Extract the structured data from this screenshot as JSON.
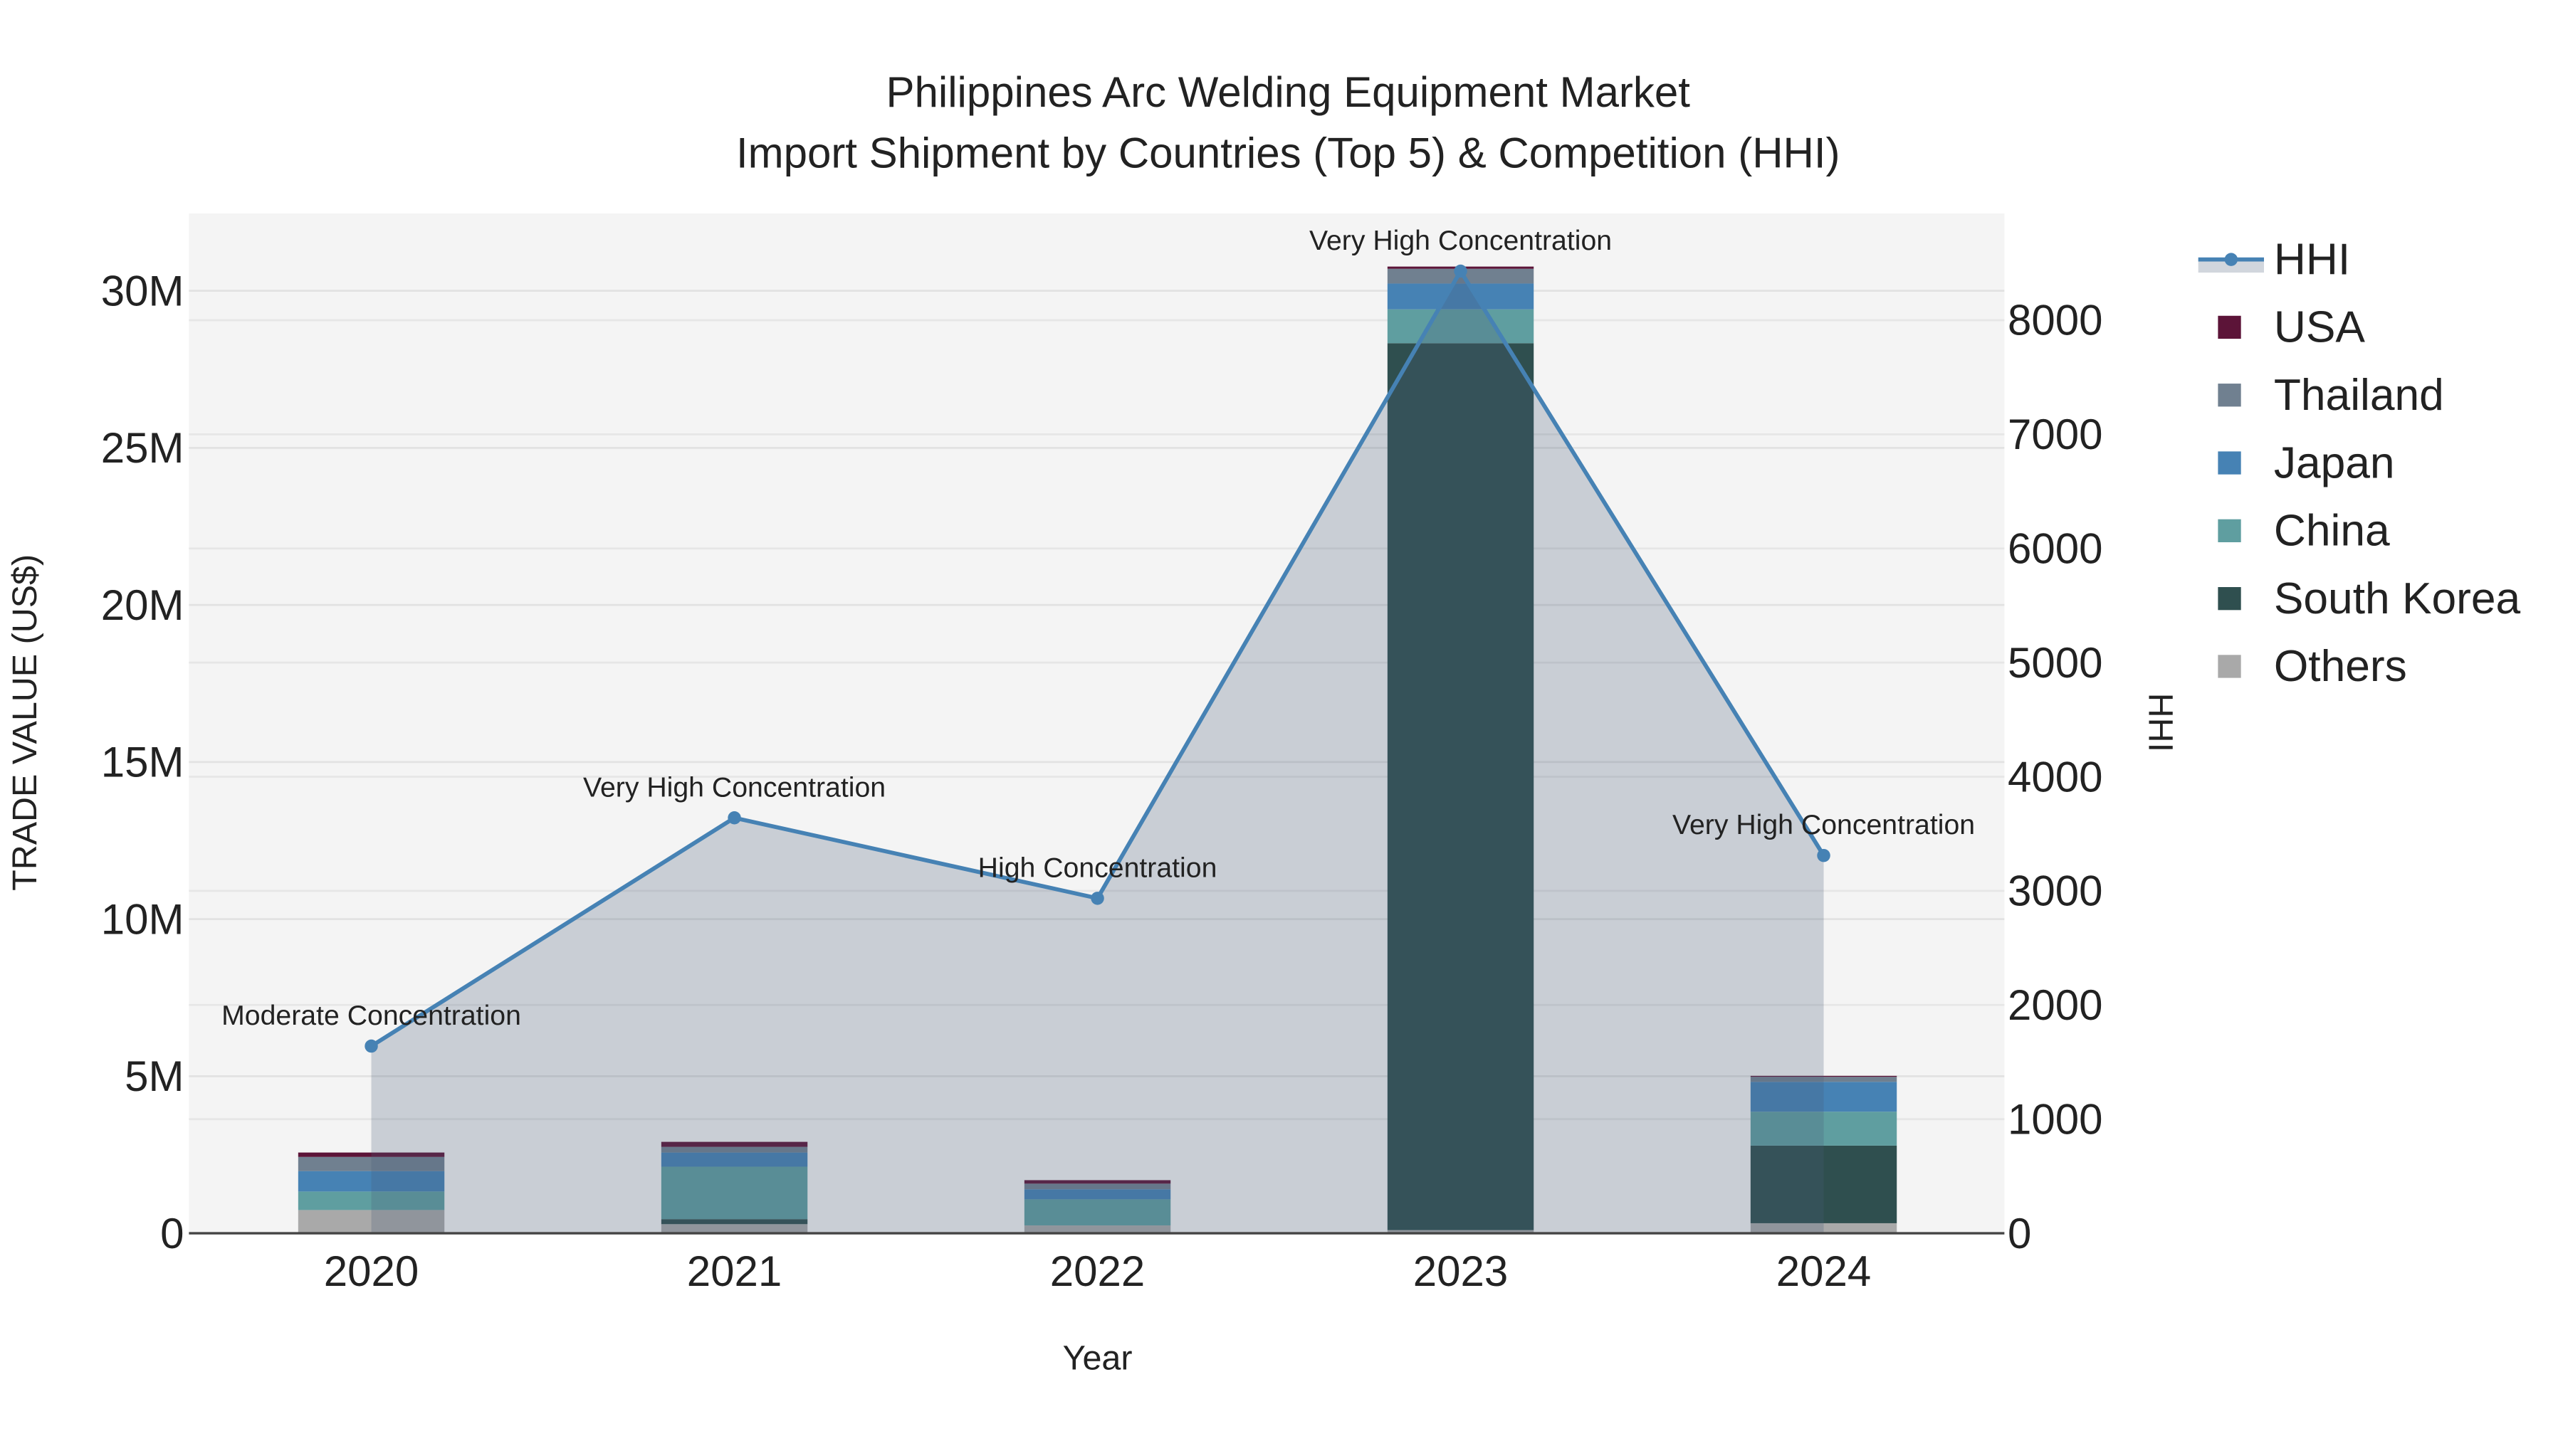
{
  "chart_data": {
    "type": "bar",
    "title_line1": "Philippines Arc Welding Equipment Market",
    "title_line2": "Import Shipment by Countries (Top 5) & Competition (HHI)",
    "xlabel": "Year",
    "ylabel": "TRADE VALUE (US$)",
    "y2label": "HHI",
    "categories": [
      "2020",
      "2021",
      "2022",
      "2023",
      "2024"
    ],
    "ylim": [
      0,
      32460000
    ],
    "y2lim": [
      0,
      8935
    ],
    "yticks": [
      0,
      5000000,
      10000000,
      15000000,
      20000000,
      25000000,
      30000000
    ],
    "ytick_labels": [
      "0",
      "5M",
      "10M",
      "15M",
      "20M",
      "25M",
      "30M"
    ],
    "y2ticks": [
      0,
      1000,
      2000,
      3000,
      4000,
      5000,
      6000,
      7000,
      8000
    ],
    "y2tick_labels": [
      "0",
      "1000",
      "2000",
      "3000",
      "4000",
      "5000",
      "6000",
      "7000",
      "8000"
    ],
    "grid": true,
    "legend_position": "right",
    "stacked": true,
    "series": [
      {
        "name": "Others",
        "color": "#a9a9a9",
        "values": [
          740000,
          290000,
          250000,
          100000,
          320000
        ]
      },
      {
        "name": "South Korea",
        "color": "#2f4f4f",
        "values": [
          0,
          160000,
          0,
          28230000,
          2470000
        ]
      },
      {
        "name": "China",
        "color": "#5f9ea0",
        "values": [
          590000,
          1670000,
          830000,
          1080000,
          1080000
        ]
      },
      {
        "name": "Japan",
        "color": "#4682b4",
        "values": [
          650000,
          450000,
          320000,
          820000,
          950000
        ]
      },
      {
        "name": "Thailand",
        "color": "#708090",
        "values": [
          450000,
          180000,
          180000,
          470000,
          160000
        ]
      },
      {
        "name": "USA",
        "color": "#5c1438",
        "values": [
          140000,
          160000,
          110000,
          70000,
          30000
        ]
      }
    ],
    "hhi": {
      "name": "HHI",
      "color": "#4682b4",
      "values": [
        1640,
        3640,
        2935,
        8430,
        3310
      ],
      "annotations": [
        "Moderate Concentration",
        "Very High Concentration",
        "High Concentration",
        "Very High Concentration",
        "Very High Concentration"
      ]
    },
    "legend_order": [
      "HHI",
      "USA",
      "Thailand",
      "Japan",
      "China",
      "South Korea",
      "Others"
    ]
  }
}
